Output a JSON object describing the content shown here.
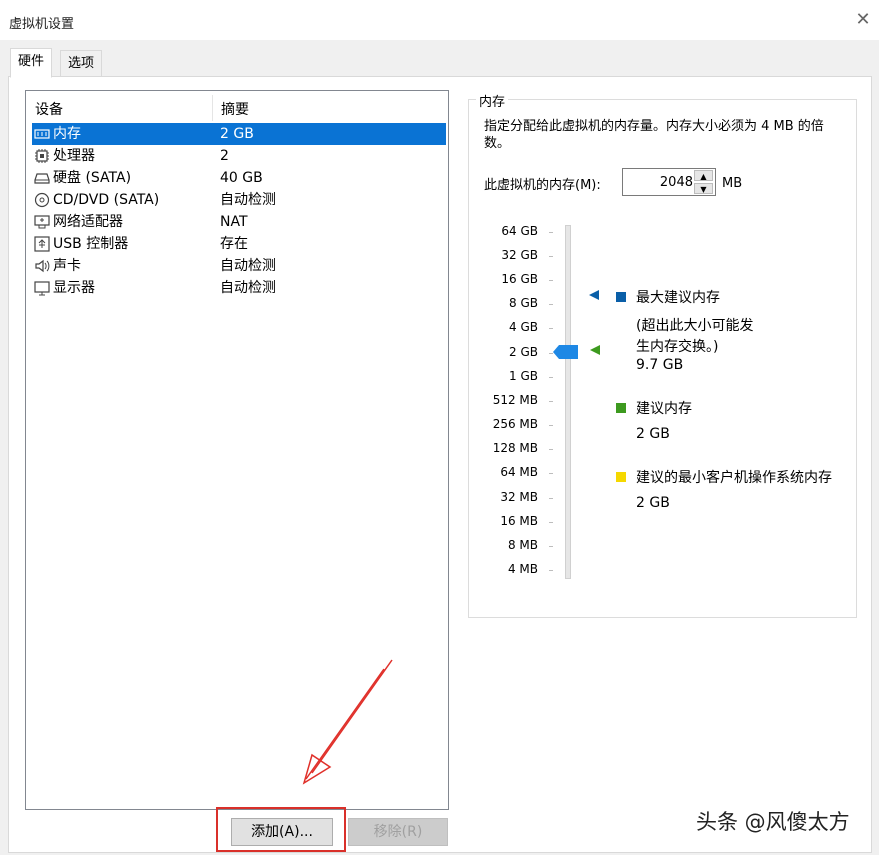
{
  "window": {
    "title": "虚拟机设置"
  },
  "tabs": [
    {
      "label": "硬件"
    },
    {
      "label": "选项"
    }
  ],
  "device_list": {
    "headers": {
      "device": "设备",
      "summary": "摘要"
    },
    "rows": [
      {
        "name": "内存",
        "summary": "2 GB",
        "icon": "memory-icon",
        "selected": true
      },
      {
        "name": "处理器",
        "summary": "2",
        "icon": "processor-icon"
      },
      {
        "name": "硬盘 (SATA)",
        "summary": "40 GB",
        "icon": "hard-disk-icon"
      },
      {
        "name": "CD/DVD (SATA)",
        "summary": "自动检测",
        "icon": "cd-dvd-icon"
      },
      {
        "name": "网络适配器",
        "summary": "NAT",
        "icon": "network-adapter-icon"
      },
      {
        "name": "USB 控制器",
        "summary": "存在",
        "icon": "usb-icon"
      },
      {
        "name": "声卡",
        "summary": "自动检测",
        "icon": "sound-icon"
      },
      {
        "name": "显示器",
        "summary": "自动检测",
        "icon": "display-icon"
      }
    ]
  },
  "buttons": {
    "add": "添加(A)...",
    "remove": "移除(R)"
  },
  "memory_panel": {
    "group_label": "内存",
    "description": "指定分配给此虚拟机的内存量。内存大小必须为 4 MB 的倍数。",
    "field_label": "此虚拟机的内存(M):",
    "value": "2048",
    "unit": "MB",
    "scale_labels": [
      "64 GB",
      "32 GB",
      "16 GB",
      "8 GB",
      "4 GB",
      "2 GB",
      "1 GB",
      "512 MB",
      "256 MB",
      "128 MB",
      "64 MB",
      "32 MB",
      "16 MB",
      "8 MB",
      "4 MB"
    ],
    "legend": {
      "max": {
        "title": "最大建议内存",
        "note": "(超出此大小可能发生内存交换。)",
        "value": "9.7 GB",
        "color": "#0a5fa8"
      },
      "recommended": {
        "title": "建议内存",
        "value": "2 GB",
        "color": "#3d9a1f"
      },
      "min": {
        "title": "建议的最小客户机操作系统内存",
        "value": "2 GB",
        "color": "#f5d800"
      }
    },
    "slider_color": "#1e88e5"
  },
  "watermark": "头条 @风傻太方"
}
